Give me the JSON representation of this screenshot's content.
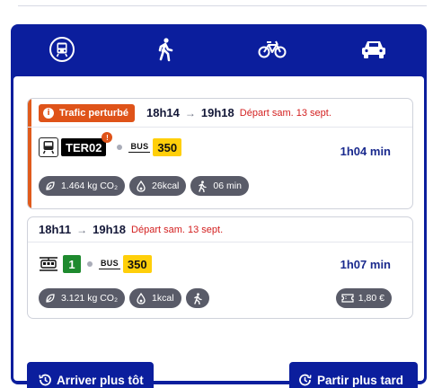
{
  "modes": [
    {
      "name": "transit",
      "icon": "train-icon",
      "active": true
    },
    {
      "name": "walk",
      "icon": "pedestrian-icon",
      "active": false
    },
    {
      "name": "bike",
      "icon": "bicycle-icon",
      "active": false
    },
    {
      "name": "car",
      "icon": "car-icon",
      "active": false
    }
  ],
  "itinerary1": {
    "alert": "Trafic perturbé",
    "depart_time": "18h14",
    "arrival_time": "19h18",
    "depart_note": "Départ sam. 13 sept.",
    "line_ter": "TER02",
    "bus_word": "BUS",
    "bus_line": "350",
    "duration": "1h04 min",
    "co2": "1.464 kg CO₂",
    "calories": "26kcal",
    "walk": "06 min"
  },
  "itinerary2": {
    "depart_time": "18h11",
    "arrival_time": "19h18",
    "depart_note": "Départ sam. 13 sept.",
    "tram_line": "1",
    "bus_word": "BUS",
    "bus_line": "350",
    "duration": "1h07 min",
    "co2": "3.121 kg CO₂",
    "calories": "1kcal",
    "price": "1,80 €"
  },
  "buttons": {
    "earlier": "Arriver plus tôt",
    "later": "Partir plus tard"
  },
  "colors": {
    "brand": "#0b1e9d",
    "alert": "#df5319",
    "bus": "#ffcf0a",
    "tram": "#1e8a2e",
    "depart_note": "#d31f1f"
  }
}
